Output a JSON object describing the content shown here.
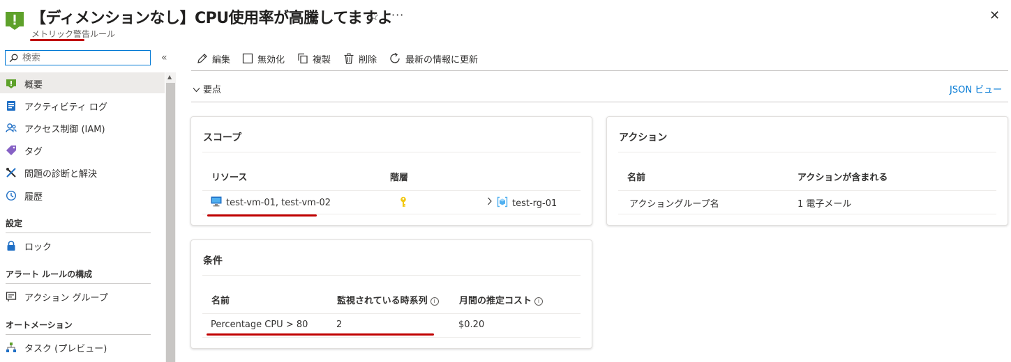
{
  "header": {
    "title": "【ディメンションなし】CPU使用率が高騰してますよ",
    "subtitle": "メトリック警告ルール",
    "star_glyph": "☆",
    "more_glyph": "···",
    "close_glyph": "✕",
    "icon": "alert-rule-icon"
  },
  "sidebar": {
    "search_placeholder": "検索",
    "collapse_glyph": "«",
    "items": [
      {
        "label": "概要",
        "icon": "overview-icon"
      },
      {
        "label": "アクティビティ ログ",
        "icon": "activity-log-icon"
      },
      {
        "label": "アクセス制御 (IAM)",
        "icon": "iam-icon"
      },
      {
        "label": "タグ",
        "icon": "tag-icon"
      },
      {
        "label": "問題の診断と解決",
        "icon": "wrench-icon"
      },
      {
        "label": "履歴",
        "icon": "history-icon"
      }
    ],
    "sections": [
      {
        "heading": "設定",
        "items": [
          {
            "label": "ロック",
            "icon": "lock-icon"
          }
        ]
      },
      {
        "heading": "アラート ルールの構成",
        "items": [
          {
            "label": "アクション グループ",
            "icon": "action-group-icon"
          }
        ]
      },
      {
        "heading": "オートメーション",
        "items": [
          {
            "label": "タスク (プレビュー)",
            "icon": "task-icon"
          }
        ]
      }
    ]
  },
  "toolbar": {
    "edit": "編集",
    "disable": "無効化",
    "duplicate": "複製",
    "delete": "削除",
    "refresh": "最新の情報に更新"
  },
  "essentials": {
    "label": "要点",
    "json_view": "JSON ビュー"
  },
  "scope_card": {
    "title": "スコープ",
    "col_resource": "リソース",
    "col_hierarchy": "階層",
    "resource_value": "test-vm-01, test-vm-02",
    "hierarchy_value": "test-rg-01"
  },
  "action_card": {
    "title": "アクション",
    "col_name": "名前",
    "col_actions": "アクションが含まれる",
    "row_name": "アクショングループ名",
    "row_actions": "1 電子メール"
  },
  "condition_card": {
    "title": "条件",
    "col_name": "名前",
    "col_timeseries": "監視されている時系列",
    "col_cost": "月間の推定コスト",
    "row_name": "Percentage CPU > 80",
    "row_timeseries": "2",
    "row_cost": "$0.20"
  },
  "colors": {
    "accent": "#0078d4",
    "annotation_red": "#c00000",
    "alert_green": "#5ea12b"
  }
}
